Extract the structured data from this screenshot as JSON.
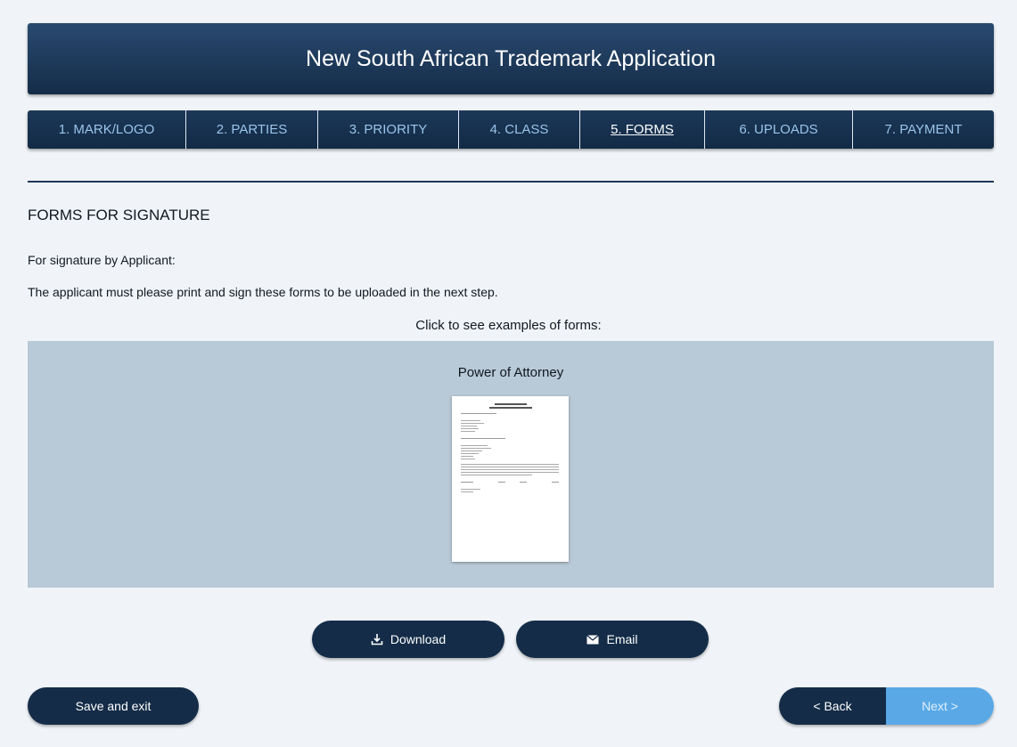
{
  "header": {
    "title": "New South African Trademark Application"
  },
  "tabs": [
    {
      "label": "1. MARK/LOGO",
      "active": false
    },
    {
      "label": "2. PARTIES",
      "active": false
    },
    {
      "label": "3. PRIORITY",
      "active": false
    },
    {
      "label": "4. CLASS",
      "active": false
    },
    {
      "label": "5. FORMS",
      "active": true
    },
    {
      "label": "6. UPLOADS",
      "active": false
    },
    {
      "label": "7. PAYMENT",
      "active": false
    }
  ],
  "section": {
    "title": "FORMS FOR SIGNATURE",
    "signature_by": "For signature by Applicant:",
    "instruction": "The applicant must please print and sign these forms to be uploaded in the next step.",
    "click_hint": "Click to see examples of forms:"
  },
  "forms": [
    {
      "title": "Power of Attorney"
    }
  ],
  "actions": {
    "download_label": "Download",
    "email_label": "Email"
  },
  "footer": {
    "save_label": "Save and exit",
    "back_label": "< Back",
    "next_label": "Next >"
  },
  "colors": {
    "navy": "#142c48",
    "tab_text": "#9ac4ea",
    "panel": "#b8c9d7",
    "next_button": "#5aa9e6",
    "background": "#f0f4f8"
  },
  "icons": {
    "download": "download-icon",
    "email": "envelope-icon"
  }
}
